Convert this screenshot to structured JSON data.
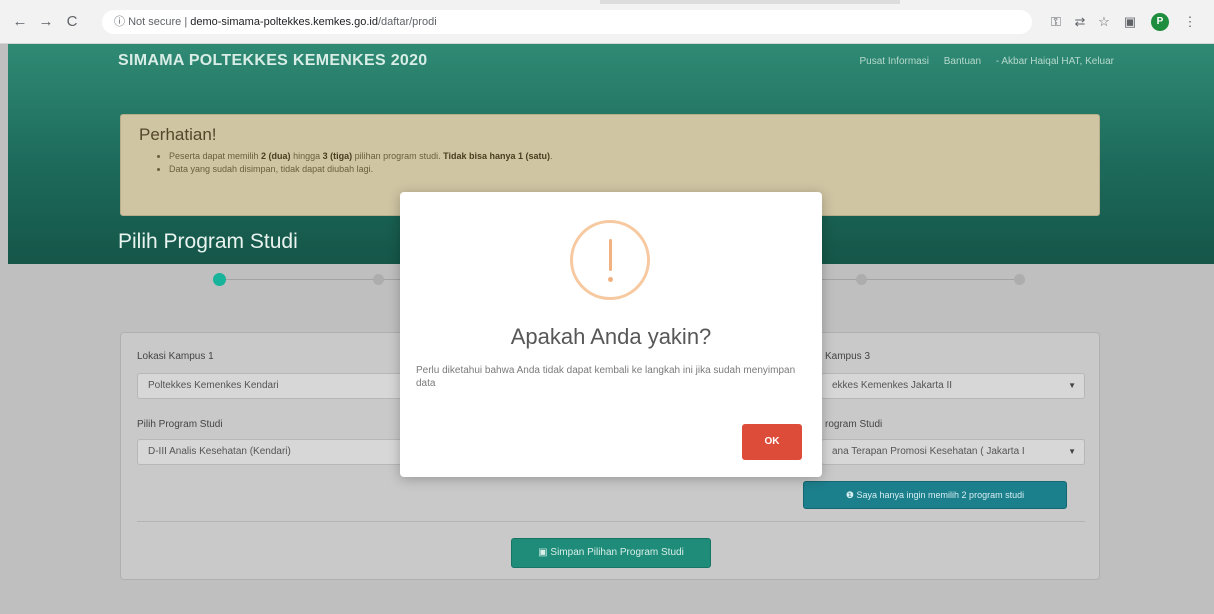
{
  "browser": {
    "back": "←",
    "forward": "→",
    "reload": "C",
    "security": "Not secure",
    "url_host": "demo-simama-poltekkes.kemkes.go.id",
    "url_path": "/daftar/prodi",
    "profile_initial": "P"
  },
  "header": {
    "brand": "SIMAMA POLTEKKES KEMENKES 2020",
    "nav": [
      "Pusat Informasi",
      "Bantuan",
      "- Akbar Haiqal HAT, Keluar"
    ]
  },
  "alert": {
    "title": "Perhatian!",
    "line1_pre": "Peserta dapat memilih ",
    "line1_b1": "2 (dua)",
    "line1_mid": " hingga ",
    "line1_b2": "3 (tiga)",
    "line1_post": " pilihan program studi. ",
    "line1_b3": "Tidak bisa hanya 1 (satu)",
    "line1_end": ".",
    "line2": "Data yang sudah disimpan, tidak dapat diubah lagi."
  },
  "section": {
    "title": "Pilih Program Studi"
  },
  "form": {
    "lokasi1_label": "Lokasi Kampus 1",
    "lokasi1_value": "Poltekkes Kemenkes Kendari",
    "prodi1_label": "Pilih Program Studi",
    "prodi1_value": "D-III Analis Kesehatan (Kendari)",
    "lokasi3_label": "Kampus 3",
    "lokasi3_value": "ekkes Kemenkes Jakarta II",
    "prodi3_label": "rogram Studi",
    "prodi3_value": "ana Terapan Promosi Kesehatan ( Jakarta I",
    "only_two_button": "Saya hanya ingin memilih 2 program studi",
    "save_button": "Simpan Pilihan Program Studi"
  },
  "modal": {
    "title": "Apakah Anda yakin?",
    "text": "Perlu diketahui bahwa Anda tidak dapat kembali ke langkah ini jika sudah menyimpan data",
    "ok": "OK"
  },
  "colors": {
    "header": "#1d6a5b",
    "accent": "#17b39a",
    "ok_button": "#dd4b39",
    "warning_icon": "#f1b181"
  }
}
